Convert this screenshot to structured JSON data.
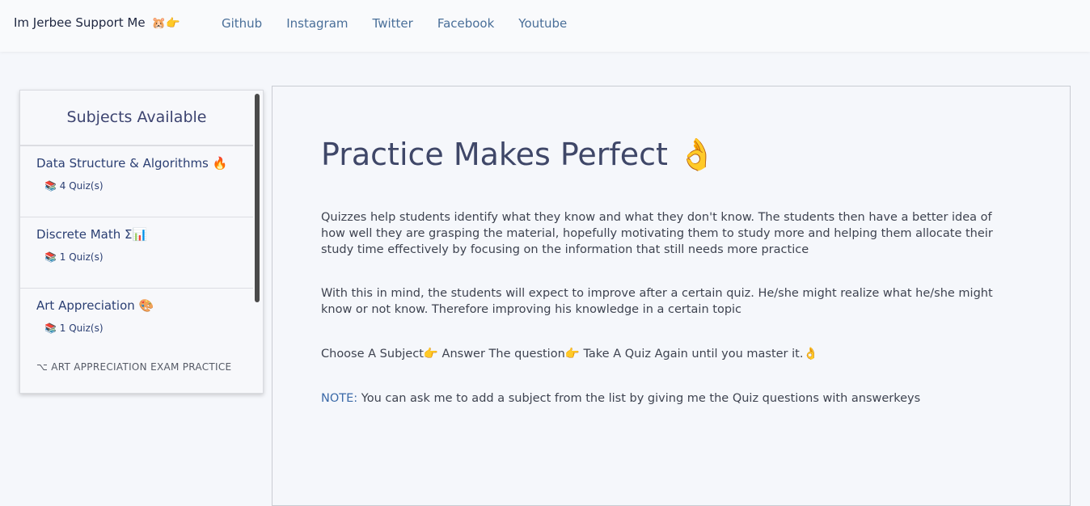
{
  "header": {
    "brand": "Im Jerbee Support Me",
    "brand_emoji": "🐹👉",
    "nav": [
      "Github",
      "Instagram",
      "Twitter",
      "Facebook",
      "Youtube"
    ]
  },
  "sidebar": {
    "title": "Subjects Available",
    "subjects": [
      {
        "name": "Data Structure & Algorithms 🔥",
        "count": "📚 4 Quiz(s)"
      },
      {
        "name": "Discrete Math Σ📊",
        "count": "📚 1 Quiz(s)"
      },
      {
        "name": "Art Appreciation 🎨",
        "count": "📚 1 Quiz(s)"
      }
    ],
    "exam_link": "⌥ ART APPRECIATION EXAM PRACTICE"
  },
  "main": {
    "title": "Practice Makes Perfect 👌",
    "paragraph1": "Quizzes help students identify what they know and what they don't know. The students then have a better idea of how well they are grasping the material, hopefully motivating them to study more and helping them allocate their study time effectively by focusing on the information that still needs more practice",
    "paragraph2": "With this in mind, the students will expect to improve after a certain quiz. He/she might realize what he/she might know or not know. Therefore improving his knowledge in a certain topic",
    "paragraph3": "Choose A Subject👉 Answer The question👉 Take A Quiz Again until you master it.👌",
    "note_label": "NOTE:",
    "note_text": " You can ask me to add a subject from the list by giving me the Quiz questions with answerkeys"
  },
  "colors": {
    "accent": "#3b6aa8",
    "nav_link": "#4a6f99",
    "title": "#3f4768"
  }
}
